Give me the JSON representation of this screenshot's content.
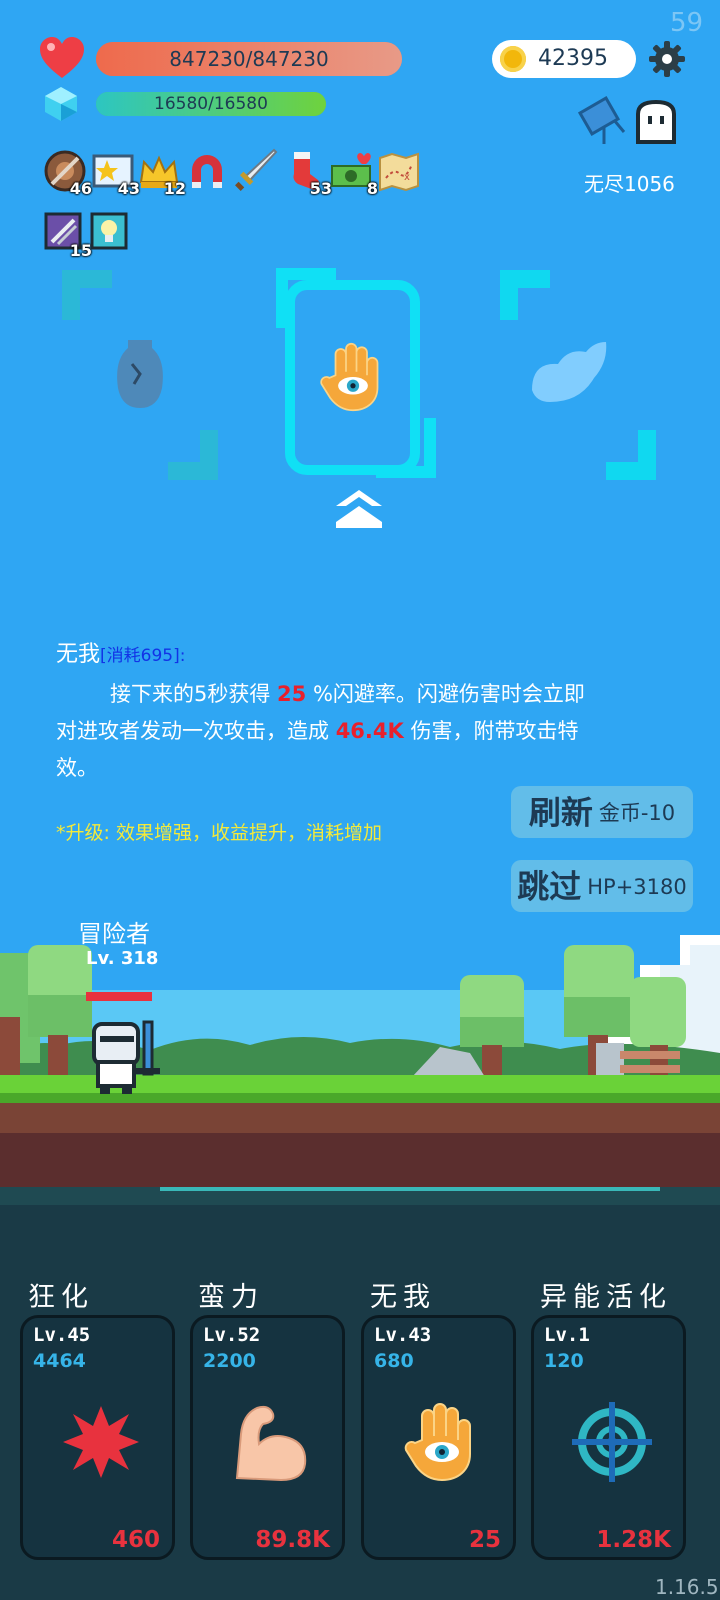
{
  "status": {
    "fps": "59",
    "version": "1.16.5",
    "hp_text": "847230/847230",
    "hp_fraction": 1.0,
    "mana_text": "16580/16580",
    "mana_fraction": 1.0,
    "coins": "42395",
    "mode_label": "无尽1056"
  },
  "items": [
    {
      "icon": "shield-icon",
      "count": "46"
    },
    {
      "icon": "star-card-icon",
      "count": "43"
    },
    {
      "icon": "crown-icon",
      "count": "12"
    },
    {
      "icon": "magnet-icon",
      "count": ""
    },
    {
      "icon": "sword-icon",
      "count": ""
    },
    {
      "icon": "sock-icon",
      "count": "53"
    },
    {
      "icon": "cash-heart-icon",
      "count": "8"
    },
    {
      "icon": "treasure-map-icon",
      "count": ""
    },
    {
      "icon": "blade-card-icon",
      "count": "15"
    },
    {
      "icon": "bulb-icon",
      "count": ""
    }
  ],
  "selection": {
    "left_option": "broken-vase-icon",
    "center_option": "eye-hand-icon",
    "right_option": "wing-icon"
  },
  "description": {
    "skill_name": "无我",
    "cost_prefix": "[",
    "cost_label": "消耗695",
    "cost_suffix": "]:",
    "line1_a": "接下来的5秒获得 ",
    "line1_hl": "25",
    "line1_b": " %闪避率。闪避伤害时会立即",
    "line2_a": "对进攻者发动一次攻击，造成 ",
    "line2_hl": "46.4K",
    "line2_b": " 伤害，附带攻击特",
    "line3": "效。",
    "upgrade_note": "*升级: 效果增强，收益提升，消耗增加"
  },
  "buttons": {
    "refresh_label": "刷新",
    "refresh_cost": "金币-10",
    "skip_label": "跳过",
    "skip_reward": "HP+3180"
  },
  "character": {
    "name": "冒险者",
    "level": "Lv. 318"
  },
  "skills": [
    {
      "title": "狂化",
      "level": "Lv.45",
      "mana": "4464",
      "cost": "460",
      "icon": "burst-icon"
    },
    {
      "title": "蛮力",
      "level": "Lv.52",
      "mana": "2200",
      "cost": "89.8K",
      "icon": "muscle-arm-icon"
    },
    {
      "title": "无我",
      "level": "Lv.43",
      "mana": "680",
      "cost": "25",
      "icon": "eye-hand-icon"
    },
    {
      "title": "异能活化",
      "level": "Lv.1",
      "mana": "120",
      "cost": "1.28K",
      "icon": "target-icon"
    }
  ],
  "colors": {
    "sky": "#2fa6f3",
    "highlight_red": "#e8202c",
    "note_yellow": "#f4ea3a",
    "cost_blue": "#1233e6",
    "frame_cyan": "#10e0f5"
  }
}
